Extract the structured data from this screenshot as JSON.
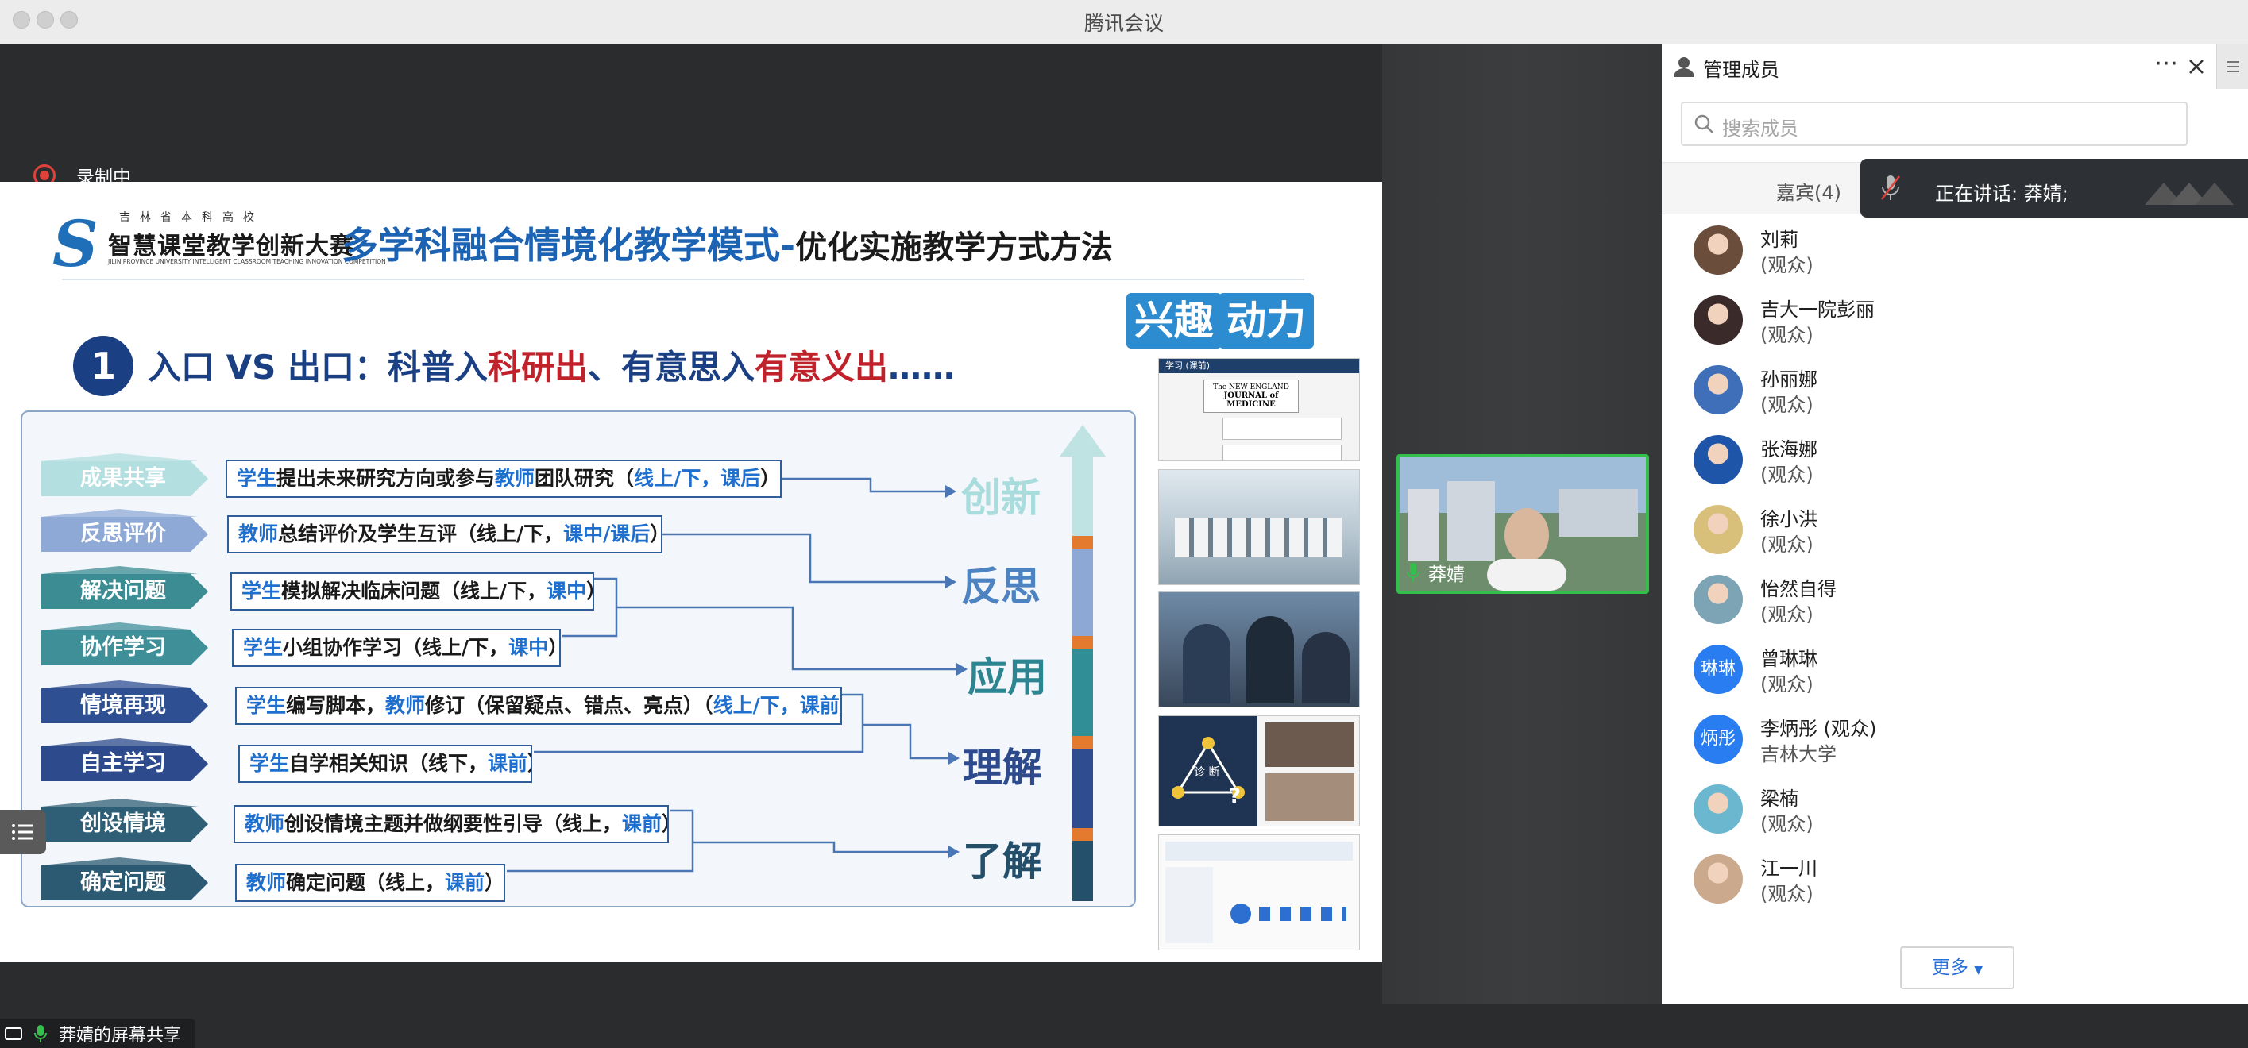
{
  "window": {
    "title": "腾讯会议"
  },
  "recording": {
    "label": "录制中"
  },
  "slide": {
    "logo": {
      "top": "吉林省本科高校",
      "name": "智慧课堂教学创新大赛",
      "en": "JILIN PROVINCE UNIVERSITY INTELLIGENT CLASSROOM TEACHING INNOVATION COMPETITION"
    },
    "title_main": "多学科融合情境化教学模式",
    "title_dash": "-",
    "title_sub": "优化实施教学方式方法",
    "tags": [
      "兴趣",
      "动力"
    ],
    "section_number": "1",
    "heading": {
      "p1": "入口 VS 出口：科普入",
      "r1": "科研出",
      "p2": "、有意思入",
      "r2": "有意义出",
      "p3": "……"
    },
    "steps": [
      {
        "label": "成果共享",
        "color": "#b3dfe0",
        "parts": [
          [
            "学生",
            "b"
          ],
          [
            "提出未来研究方向或参与",
            ""
          ],
          [
            "教师",
            "b"
          ],
          [
            "团队研究（",
            ""
          ],
          [
            "线上/下，课后",
            "b"
          ],
          [
            "）",
            ""
          ]
        ]
      },
      {
        "label": "反思评价",
        "color": "#8fa9d6",
        "parts": [
          [
            "教师",
            "b"
          ],
          [
            "总结评价及学生互评（线上/下，",
            ""
          ],
          [
            "课中/课后",
            "b"
          ],
          [
            "）",
            ""
          ]
        ]
      },
      {
        "label": "解决问题",
        "color": "#3c8c93",
        "parts": [
          [
            "学生",
            "b"
          ],
          [
            "模拟解决临床问题（线上/下，",
            ""
          ],
          [
            "课中",
            "b"
          ],
          [
            "）",
            ""
          ]
        ]
      },
      {
        "label": "协作学习",
        "color": "#3f8f99",
        "parts": [
          [
            "学生",
            "b"
          ],
          [
            "小组协作学习（线上/下，",
            ""
          ],
          [
            "课中",
            "b"
          ],
          [
            "）",
            ""
          ]
        ]
      },
      {
        "label": "情境再现",
        "color": "#2f4f93",
        "parts": [
          [
            "学生",
            "b"
          ],
          [
            "编写脚本，",
            ""
          ],
          [
            "教师",
            "b"
          ],
          [
            "修订（保留疑点、错点、亮点）（",
            ""
          ],
          [
            "线上/下，课前",
            "b"
          ],
          [
            "）",
            ""
          ]
        ]
      },
      {
        "label": "自主学习",
        "color": "#2c4a8c",
        "parts": [
          [
            "学生",
            "b"
          ],
          [
            "自学相关知识（线下，",
            ""
          ],
          [
            "课前",
            "b"
          ],
          [
            "）",
            ""
          ]
        ]
      },
      {
        "label": "创设情境",
        "color": "#2e5f76",
        "parts": [
          [
            "教师",
            "b"
          ],
          [
            "创设情境主题并做纲要性引导（线上，",
            ""
          ],
          [
            "课前",
            "b"
          ],
          [
            "）",
            ""
          ]
        ]
      },
      {
        "label": "确定问题",
        "color": "#2b5a72",
        "parts": [
          [
            "教师",
            "b"
          ],
          [
            "确定问题（线上，",
            ""
          ],
          [
            "课前",
            "b"
          ],
          [
            "）",
            ""
          ]
        ]
      }
    ],
    "outcomes": [
      {
        "label": "创新",
        "color": "#a9dcdd"
      },
      {
        "label": "反思",
        "color": "#4e83c2"
      },
      {
        "label": "应用",
        "color": "#2c8590"
      },
      {
        "label": "理解",
        "color": "#2c4a8c"
      },
      {
        "label": "了解",
        "color": "#234f6a"
      }
    ],
    "thumbs": {
      "journal_banner": "学习 (课前)",
      "journal_line1": "The NEW ENGLAND",
      "journal_line2": "JOURNAL of MEDICINE",
      "diagram_center": "诊 断",
      "diagram_q": "?"
    }
  },
  "camera": {
    "name": "莽婧"
  },
  "screen_share": {
    "label": "莽婧的屏幕共享"
  },
  "sidebar": {
    "title": "管理成员",
    "search_placeholder": "搜索成员",
    "tab": "嘉宾(4)",
    "speaking": "正在讲话: 莽婧;",
    "members": [
      {
        "name": "刘莉",
        "role": "(观众)",
        "avatar": "photo",
        "color": "#6b4d3c"
      },
      {
        "name": "吉大一院彭丽",
        "role": "(观众)",
        "avatar": "photo",
        "color": "#3a2a2a"
      },
      {
        "name": "孙丽娜",
        "role": "(观众)",
        "avatar": "photo",
        "color": "#3f6fb8"
      },
      {
        "name": "张海娜",
        "role": "(观众)",
        "avatar": "photo",
        "color": "#1f55a8"
      },
      {
        "name": "徐小洪",
        "role": "(观众)",
        "avatar": "photo",
        "color": "#d9c07a"
      },
      {
        "name": "怡然自得",
        "role": "(观众)",
        "avatar": "photo",
        "color": "#7da4b5"
      },
      {
        "name": "曾琳琳",
        "role": "(观众)",
        "avatar": "text",
        "avatar_text": "琳琳",
        "color": "#2a7df0"
      },
      {
        "name": "李炳彤 (观众)",
        "role": "吉林大学",
        "avatar": "text",
        "avatar_text": "炳彤",
        "color": "#2a7df0"
      },
      {
        "name": "梁楠",
        "role": "(观众)",
        "avatar": "photo",
        "color": "#6bb7cf"
      },
      {
        "name": "江一川",
        "role": "(观众)",
        "avatar": "photo",
        "color": "#caa98c"
      }
    ],
    "more": "更多"
  },
  "colors": {
    "accent": "#1c63b3",
    "red": "#c0222b",
    "speaking_bg": "#2d3136",
    "camera_border": "#32c04a"
  },
  "icons": [
    "person-icon",
    "more-icon",
    "close-icon",
    "menu-icon",
    "search-icon",
    "mic-muted-icon",
    "mic-icon",
    "list-icon",
    "share-icon",
    "dropdown-icon"
  ]
}
